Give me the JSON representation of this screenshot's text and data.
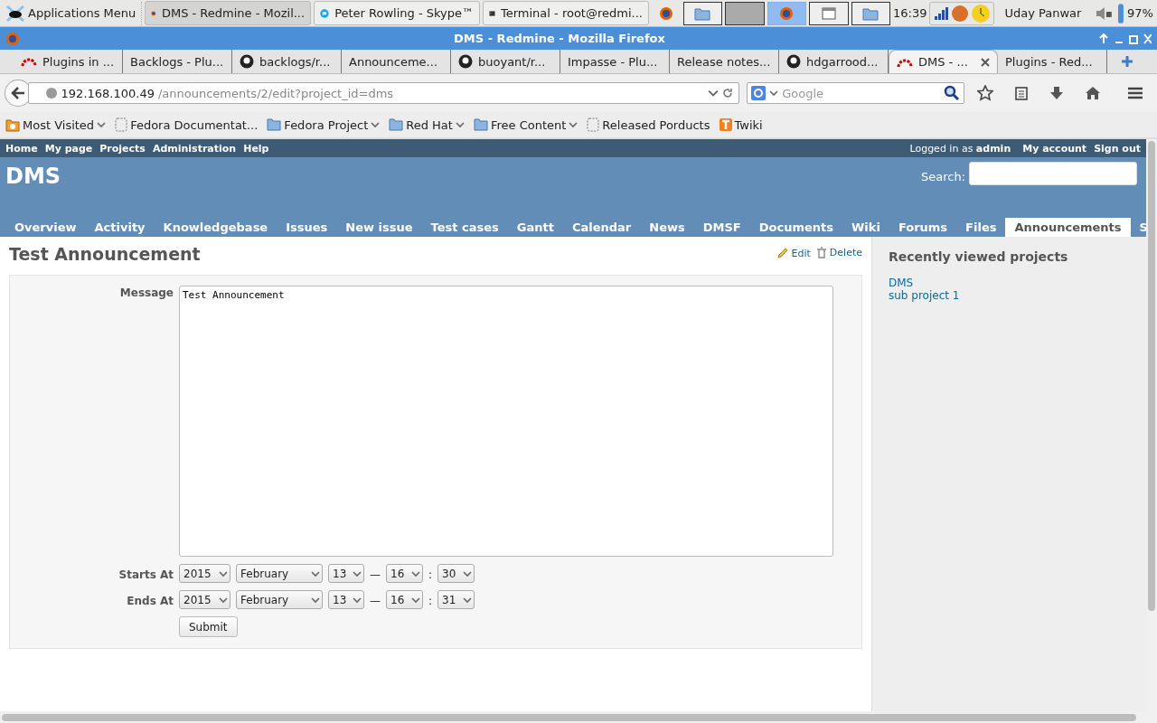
{
  "taskbar": {
    "apps_menu": "Applications Menu",
    "tasks": [
      {
        "label": "DMS - Redmine - Mozil...",
        "kind": "firefox",
        "selected": true
      },
      {
        "label": "Peter Rowling - Skype™",
        "kind": "skype",
        "selected": false
      },
      {
        "label": "Terminal - root@redmi...",
        "kind": "terminal",
        "selected": false
      }
    ],
    "workspaces": [
      {
        "kind": "folder",
        "selected": false
      },
      {
        "kind": "blank",
        "selected": false
      },
      {
        "kind": "firefox",
        "selected": true
      },
      {
        "kind": "window",
        "selected": false
      },
      {
        "kind": "folder",
        "selected": false
      }
    ],
    "clock": "16:39",
    "user": "Uday Panwar",
    "battery": "97%"
  },
  "window": {
    "title": "DMS - Redmine - Mozilla Firefox"
  },
  "browser_tabs": [
    {
      "label": "Plugins in ...",
      "kind": "redmine",
      "selected": false
    },
    {
      "label": "Backlogs - Plu...",
      "kind": "plain",
      "selected": false
    },
    {
      "label": "backlogs/r...",
      "kind": "github",
      "selected": false
    },
    {
      "label": "Announceme...",
      "kind": "plain",
      "selected": false
    },
    {
      "label": "buoyant/r...",
      "kind": "github",
      "selected": false
    },
    {
      "label": "Impasse - Plu...",
      "kind": "plain",
      "selected": false
    },
    {
      "label": "Release notes...",
      "kind": "plain",
      "selected": false
    },
    {
      "label": "hdgarrood...",
      "kind": "github",
      "selected": false
    },
    {
      "label": "DMS - ...",
      "kind": "redmine",
      "selected": true
    },
    {
      "label": "Plugins - Red...",
      "kind": "plain",
      "selected": false
    }
  ],
  "address": {
    "host": "192.168.100.49",
    "path": "/announcements/2/edit?project_id=dms"
  },
  "web_search": {
    "placeholder": "Google"
  },
  "bookmarks": [
    {
      "label": "Most Visited",
      "kind": "recent",
      "dropdown": true
    },
    {
      "label": "Fedora Documentat...",
      "kind": "page",
      "dropdown": false
    },
    {
      "label": "Fedora Project",
      "kind": "folder",
      "dropdown": true
    },
    {
      "label": "Red Hat",
      "kind": "folder",
      "dropdown": true
    },
    {
      "label": "Free Content",
      "kind": "folder",
      "dropdown": true
    },
    {
      "label": "Released Porducts",
      "kind": "page",
      "dropdown": false
    },
    {
      "label": "Twiki",
      "kind": "twiki",
      "dropdown": false
    }
  ],
  "top_menu": [
    "Home",
    "My page",
    "Projects",
    "Administration",
    "Help"
  ],
  "logged_in": {
    "prefix": "Logged in as",
    "user": "admin"
  },
  "account_links": [
    "My account",
    "Sign out"
  ],
  "project": {
    "title": "DMS",
    "search_label": "Search:"
  },
  "main_menu": [
    {
      "label": "Overview",
      "selected": false
    },
    {
      "label": "Activity",
      "selected": false
    },
    {
      "label": "Knowledgebase",
      "selected": false
    },
    {
      "label": "Issues",
      "selected": false
    },
    {
      "label": "New issue",
      "selected": false
    },
    {
      "label": "Test cases",
      "selected": false
    },
    {
      "label": "Gantt",
      "selected": false
    },
    {
      "label": "Calendar",
      "selected": false
    },
    {
      "label": "News",
      "selected": false
    },
    {
      "label": "DMSF",
      "selected": false
    },
    {
      "label": "Documents",
      "selected": false
    },
    {
      "label": "Wiki",
      "selected": false
    },
    {
      "label": "Forums",
      "selected": false
    },
    {
      "label": "Files",
      "selected": false
    },
    {
      "label": "Announcements",
      "selected": true
    },
    {
      "label": "S",
      "selected": false
    }
  ],
  "content": {
    "title": "Test Announcement",
    "actions": [
      {
        "label": "Edit",
        "kind": "pencil"
      },
      {
        "label": "Delete",
        "kind": "trash"
      }
    ],
    "message": {
      "label": "Message",
      "value": "Test Announcement"
    },
    "dates": [
      {
        "label": "Starts At",
        "year": "2015",
        "month": "February",
        "day": "13",
        "hour": "16",
        "minute": "30",
        "dash": "—",
        "colon": ":"
      },
      {
        "label": "Ends At",
        "year": "2015",
        "month": "February",
        "day": "13",
        "hour": "16",
        "minute": "31",
        "dash": "—",
        "colon": ":"
      }
    ],
    "submit": "Submit"
  },
  "sidebar": {
    "heading": "Recently viewed projects",
    "projects": [
      "DMS",
      "sub project 1"
    ]
  }
}
